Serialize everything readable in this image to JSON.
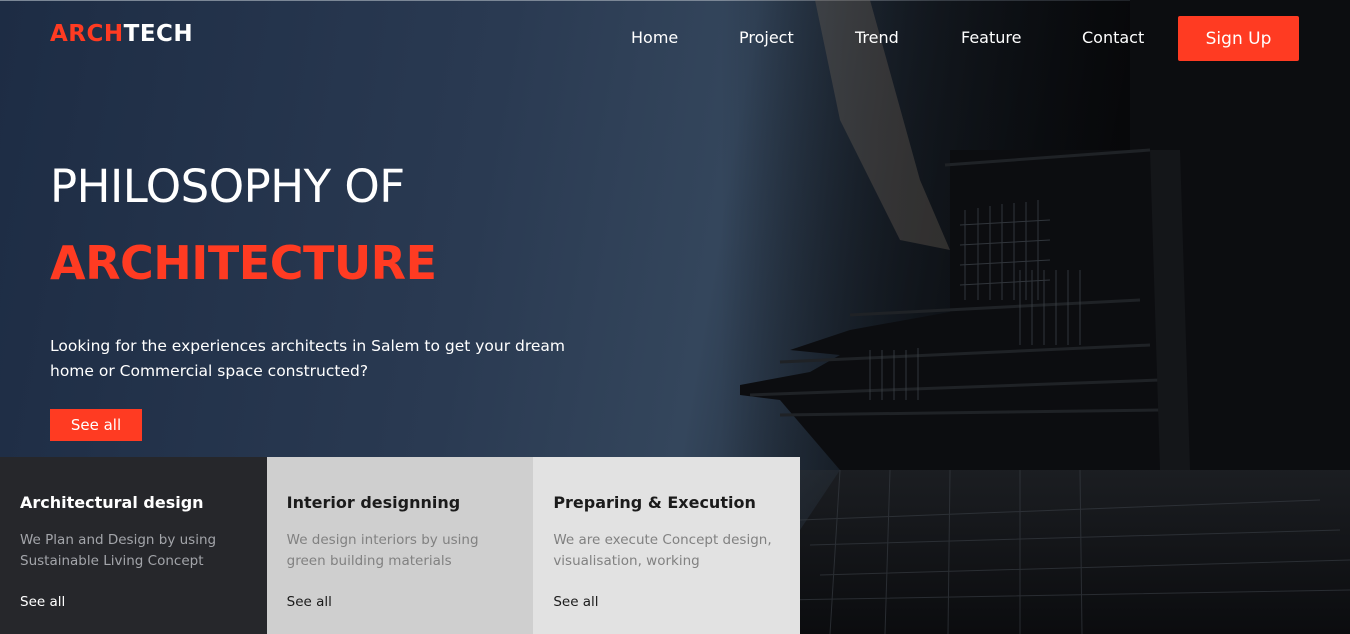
{
  "brand": {
    "accent": "ARCH",
    "rest": "TECH"
  },
  "nav": {
    "items": [
      "Home",
      "Project",
      "Trend",
      "Feature",
      "Contact"
    ],
    "signup_label": "Sign Up"
  },
  "hero": {
    "title_line1": "PHILOSOPHY OF",
    "title_line2": "ARCHITECTURE",
    "description": "Looking for the experiences architects in Salem to get your dream home or Commercial space constructed?",
    "button_label": "See all"
  },
  "services": [
    {
      "title": "Architectural design",
      "text": "We Plan and Design by using Sustainable Living Concept",
      "link": "See all"
    },
    {
      "title": "Interior designning",
      "text": "We design interiors by using green building materials",
      "link": "See all"
    },
    {
      "title": "Preparing & Execution",
      "text": "We are execute Concept design, visualisation, working",
      "link": "See all"
    }
  ],
  "colors": {
    "accent": "#ff3b22",
    "hero_bg": "#2a3a52",
    "card_dark": "#26272b",
    "card_mid": "#cfcfcf",
    "card_light": "#e2e2e2"
  }
}
